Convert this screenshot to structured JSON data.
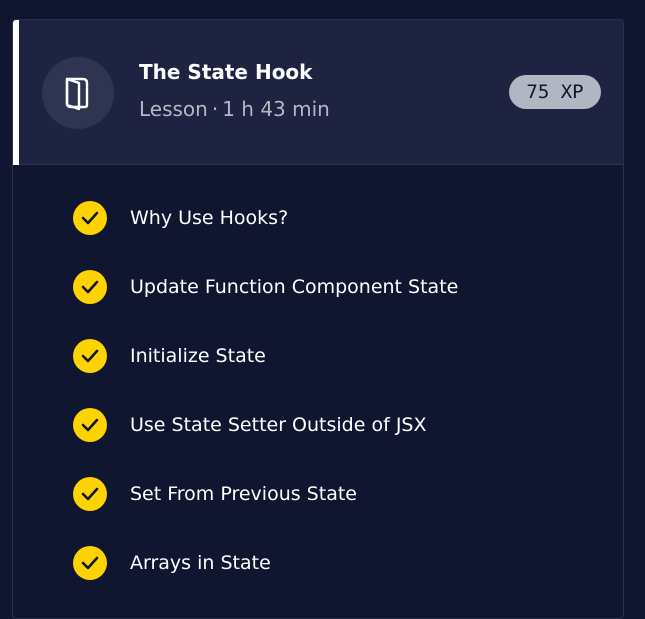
{
  "lesson": {
    "title": "The State Hook",
    "type": "Lesson",
    "separator": "·",
    "duration": "1 h 43 min",
    "xp": "75 XP",
    "icon": "book-icon"
  },
  "colors": {
    "background": "#10162f",
    "header_background": "#1d2340",
    "accent_bar": "#ffffff",
    "check": "#ffd300",
    "xp_badge": "#b2b6c3"
  },
  "items": [
    {
      "label": "Why Use Hooks?",
      "completed": true
    },
    {
      "label": "Update Function Component State",
      "completed": true
    },
    {
      "label": "Initialize State",
      "completed": true
    },
    {
      "label": "Use State Setter Outside of JSX",
      "completed": true
    },
    {
      "label": "Set From Previous State",
      "completed": true
    },
    {
      "label": "Arrays in State",
      "completed": true
    }
  ]
}
